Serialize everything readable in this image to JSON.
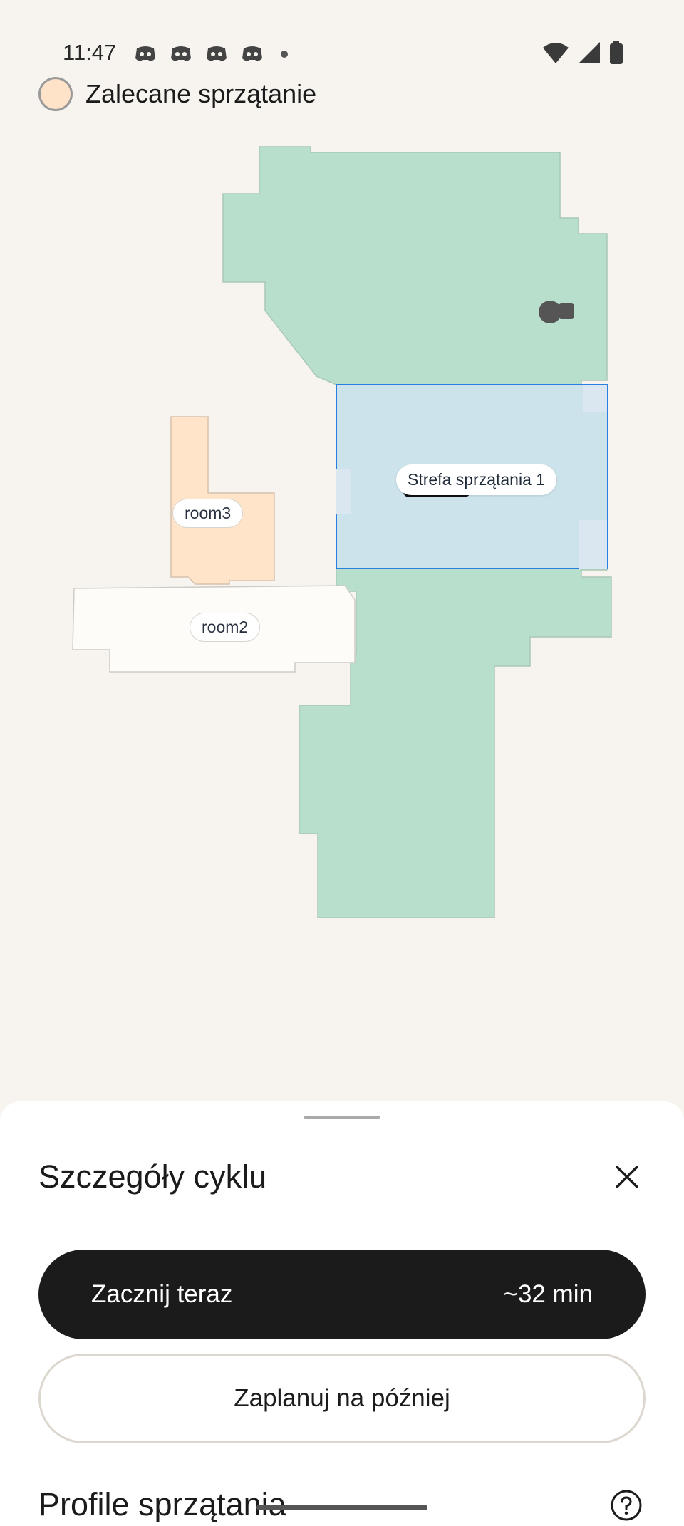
{
  "status_bar": {
    "time": "11:47",
    "notification_icons": [
      "discord-icon",
      "discord-icon",
      "discord-icon",
      "discord-icon"
    ],
    "system_icons": [
      "wifi-icon",
      "signal-icon",
      "battery-icon"
    ]
  },
  "legend": {
    "label": "Zalecane sprzątanie",
    "swatch_color": "#ffe3c8"
  },
  "map": {
    "colors": {
      "cleaned_area": "#b8dfcc",
      "room3": "#ffe4c9",
      "room2": "#fdfcf9",
      "zone_fill": "#cde3ec",
      "zone_border": "#2a7de1"
    },
    "rooms": [
      {
        "label": "room3"
      },
      {
        "label": "room2"
      }
    ],
    "zone": {
      "label": "Strefa sprzątania 1"
    },
    "icons": [
      "robot-dock-icon",
      "robot-icon"
    ]
  },
  "sheet": {
    "title": "Szczegóły cyklu",
    "start_button": {
      "label": "Zacznij teraz",
      "duration": "~32 min"
    },
    "schedule_button": {
      "label": "Zaplanuj na później"
    },
    "profiles_title": "Profile sprzątania"
  }
}
